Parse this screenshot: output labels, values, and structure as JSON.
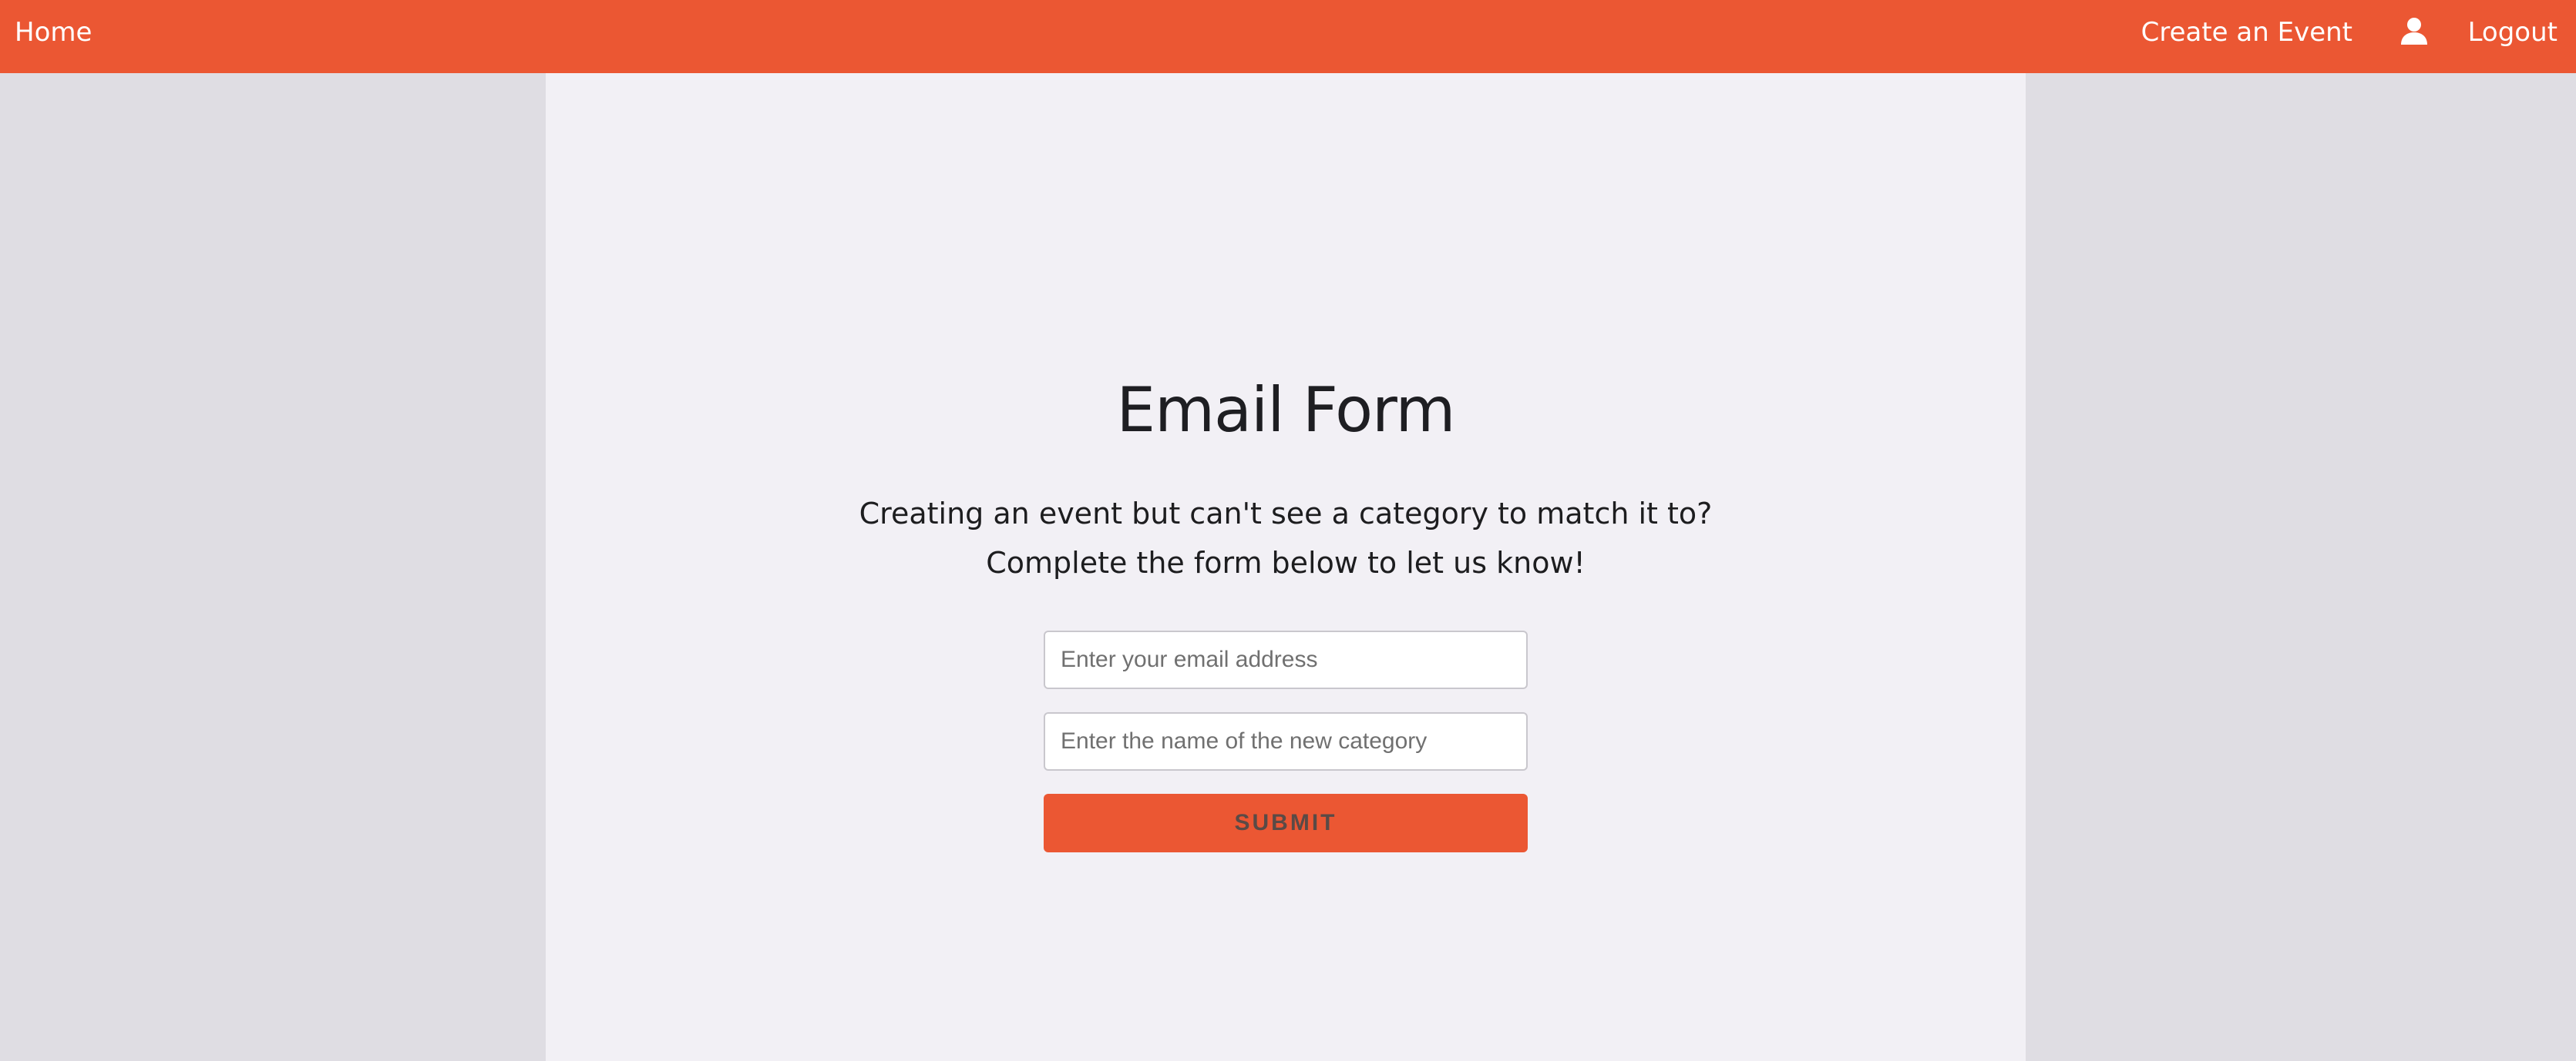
{
  "navbar": {
    "home_label": "Home",
    "create_event_label": "Create an Event",
    "user_icon": "user-icon",
    "logout_label": "Logout",
    "color": "#eb5733"
  },
  "main": {
    "title": "Email Form",
    "description": "Creating an event but can't see a category to match it to? Complete the form below to let us know!",
    "form": {
      "email_placeholder": "Enter your email address",
      "email_value": "",
      "category_placeholder": "Enter the name of the new category",
      "category_value": "",
      "submit_label": "SUBMIT"
    }
  },
  "colors": {
    "accent": "#eb5733",
    "page_background": "#dfdde3",
    "panel_background": "#f2f0f5"
  }
}
